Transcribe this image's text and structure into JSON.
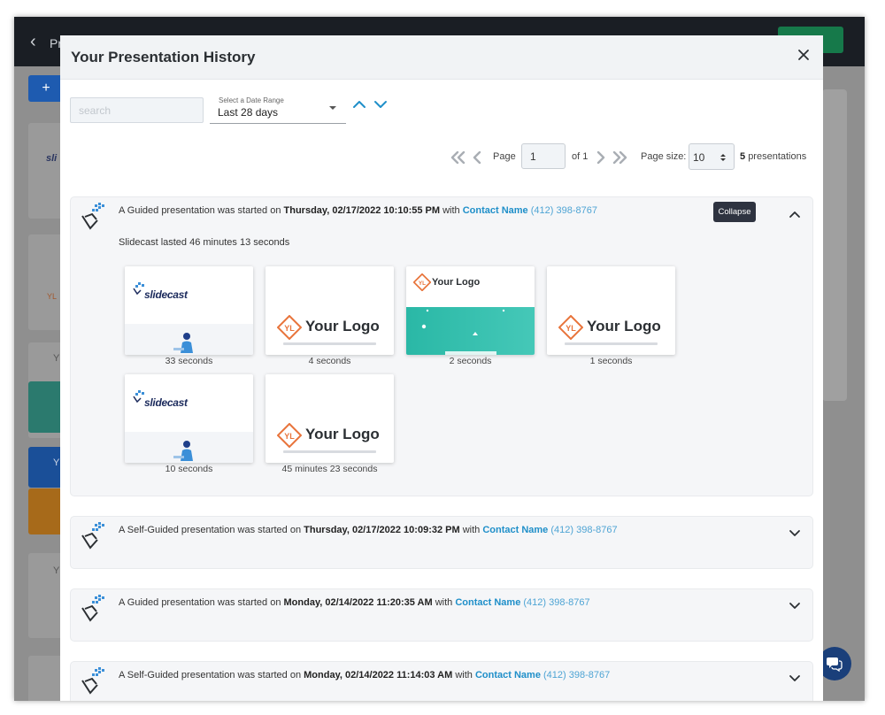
{
  "background_app": {
    "back_label": "Pr",
    "add_label": "+",
    "logo_fragments": [
      "sli",
      "YL",
      "Y",
      "Y",
      "Y"
    ]
  },
  "modal": {
    "title": "Your Presentation History",
    "close_label": "×",
    "search": {
      "placeholder": "search",
      "value": ""
    },
    "date_range": {
      "label": "Select a Date Range",
      "value": "Last 28 days"
    },
    "pagination": {
      "page_label": "Page",
      "page_value": "1",
      "of_label": "of 1",
      "page_size_label": "Page size:",
      "page_size_value": "10",
      "count_number": "5",
      "count_suffix": "presentations"
    },
    "tooltip": "Collapse",
    "history": [
      {
        "prefix": "A Guided presentation was started on",
        "date": "Thursday, 02/17/2022 10:10:55 PM",
        "with": "with",
        "contact": "Contact Name",
        "phone": "(412) 398-8767",
        "expanded": true,
        "duration": "Slidecast lasted 46 minutes 13 seconds",
        "slides": [
          {
            "kind": "slidecast",
            "caption": "33 seconds"
          },
          {
            "kind": "yourlogo",
            "caption": "4 seconds",
            "logo_text": "Your Logo",
            "badge": "YL"
          },
          {
            "kind": "teal",
            "caption": "2 seconds",
            "logo_text": "Your Logo",
            "badge": "YL"
          },
          {
            "kind": "yourlogo",
            "caption": "1 seconds",
            "logo_text": "Your Logo",
            "badge": "YL"
          },
          {
            "kind": "slidecast",
            "caption": "10 seconds"
          },
          {
            "kind": "yourlogo",
            "caption": "45 minutes 23 seconds",
            "logo_text": "Your Logo",
            "badge": "YL"
          }
        ]
      },
      {
        "prefix": "A Self-Guided presentation was started on",
        "date": "Thursday, 02/17/2022 10:09:32 PM",
        "with": "with",
        "contact": "Contact Name",
        "phone": "(412) 398-8767",
        "expanded": false
      },
      {
        "prefix": "A Guided presentation was started on",
        "date": "Monday, 02/14/2022 11:20:35 AM",
        "with": "with",
        "contact": "Contact Name",
        "phone": "(412) 398-8767",
        "expanded": false
      },
      {
        "prefix": "A Self-Guided presentation was started on",
        "date": "Monday, 02/14/2022 11:14:03 AM",
        "with": "with",
        "contact": "Contact Name",
        "phone": "(412) 398-8767",
        "expanded": false
      }
    ]
  },
  "colors": {
    "accent_blue": "#1f8fc9",
    "phone_blue": "#4ea4d4",
    "logo_orange": "#e8743b",
    "teal": "#2ab8a6",
    "overlay_gray": "#8f8f8f"
  },
  "slidecast_brand": "slidecast"
}
